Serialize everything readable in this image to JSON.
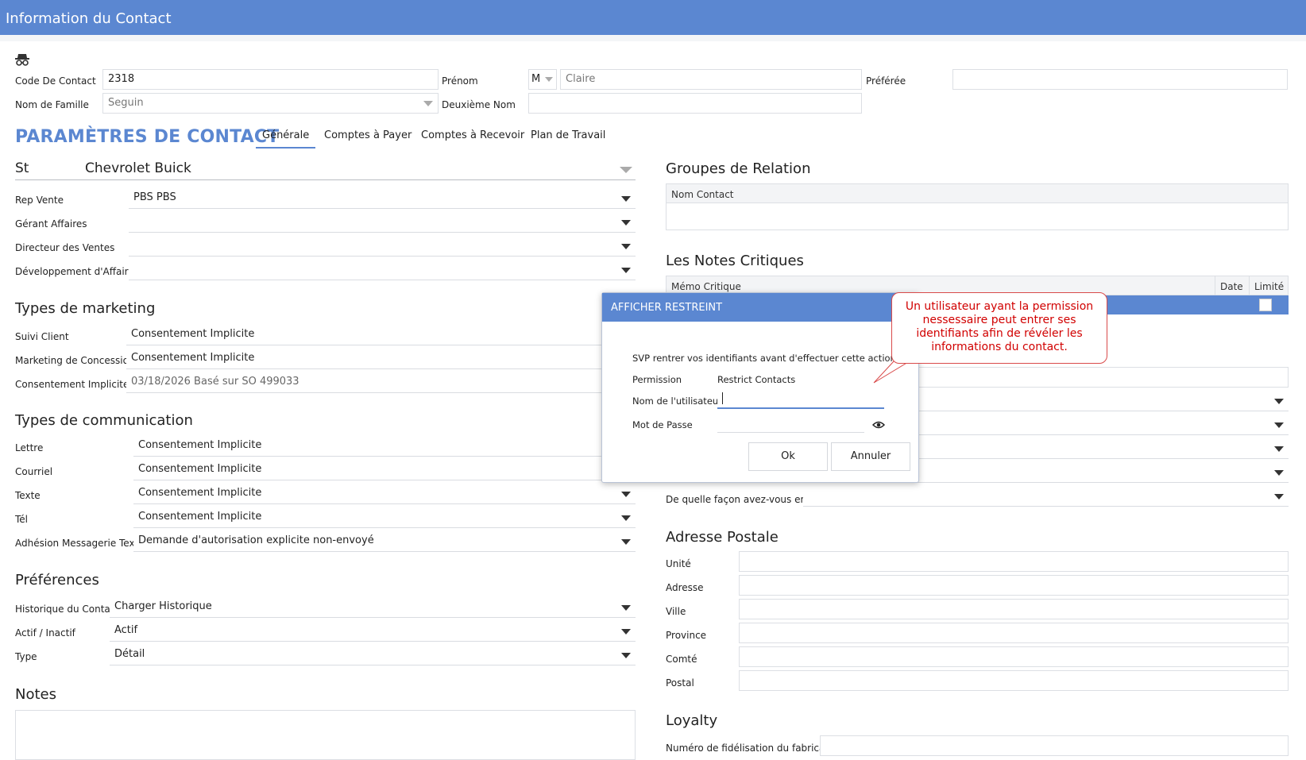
{
  "window": {
    "title": "Information du Contact"
  },
  "header": {
    "contact_code_label": "Code De Contact",
    "contact_code_value": "2318",
    "first_name_label": "Prénom",
    "salutation_value": "M",
    "first_name_value": "Claire",
    "preferred_label": "Préférée",
    "preferred_value": "",
    "last_name_label": "Nom de Famille",
    "last_name_value": "Seguin",
    "middle_name_label": "Deuxième Nom",
    "middle_name_value": ""
  },
  "settings": {
    "title": "PARAMÈTRES DE CONTACT",
    "tabs": [
      "Générale",
      "Comptes à Payer",
      "Comptes à Recevoir",
      "Plan de Travail"
    ],
    "active_tab": "Générale"
  },
  "store": {
    "label": "St",
    "value": "Chevrolet Buick"
  },
  "staff": [
    {
      "label": "Rep Vente",
      "value": "PBS PBS"
    },
    {
      "label": "Gérant Affaires",
      "value": ""
    },
    {
      "label": "Directeur des Ventes",
      "value": ""
    },
    {
      "label": "Développement d'Affaires",
      "value": ""
    }
  ],
  "marketing": {
    "title": "Types de marketing",
    "rows": [
      {
        "label": "Suivi Client",
        "value": "Consentement Implicite"
      },
      {
        "label": "Marketing de Concession",
        "value": "Consentement Implicite"
      },
      {
        "label": "Consentement Implicite",
        "value": "03/18/2026 Basé sur SO 499033"
      }
    ]
  },
  "communication": {
    "title": "Types de communication",
    "rows": [
      {
        "label": "Lettre",
        "value": "Consentement Implicite"
      },
      {
        "label": "Courriel",
        "value": "Consentement Implicite"
      },
      {
        "label": "Texte",
        "value": "Consentement Implicite"
      },
      {
        "label": "Tél",
        "value": "Consentement Implicite"
      },
      {
        "label": "Adhésion Messagerie Texte",
        "value": "Demande d'autorisation explicite non-envoyé"
      }
    ]
  },
  "preferences": {
    "title": "Préférences",
    "rows": [
      {
        "label": "Historique du Contact",
        "value": "Charger Historique"
      },
      {
        "label": "Actif / Inactif",
        "value": "Actif"
      },
      {
        "label": "Type",
        "value": "Détail"
      }
    ]
  },
  "notes": {
    "title": "Notes"
  },
  "relation_groups": {
    "title": "Groupes de Relation",
    "column": "Nom Contact"
  },
  "critical_notes": {
    "title": "Les Notes Critiques",
    "columns": [
      "Mémo Critique",
      "Date",
      "Limité"
    ]
  },
  "how_heard": {
    "label": "De quelle façon avez-vous ent..."
  },
  "postal": {
    "title": "Adresse Postale",
    "rows": [
      "Unité",
      "Adresse",
      "Ville",
      "Province",
      "Comté",
      "Postal"
    ]
  },
  "loyalty": {
    "title": "Loyalty",
    "label": "Numéro de fidélisation du fabricant"
  },
  "dialog": {
    "title": "AFFICHER RESTREINT",
    "message": "SVP rentrer vos identifiants avant d'effectuer cette action:",
    "permission_label": "Permission",
    "permission_value": "Restrict Contacts",
    "username_label": "Nom de l'utilisateur",
    "password_label": "Mot de Passe",
    "ok_label": "Ok",
    "cancel_label": "Annuler"
  },
  "callout": {
    "text": "Un utilisateur ayant la permission nessessaire peut entrer ses identifiants afin de révéler les informations du contact."
  },
  "colors": {
    "accent": "#5b87d1",
    "callout_text": "#d10000"
  },
  "icons": {
    "header": "spy-icon",
    "password_toggle": "eye-icon"
  }
}
